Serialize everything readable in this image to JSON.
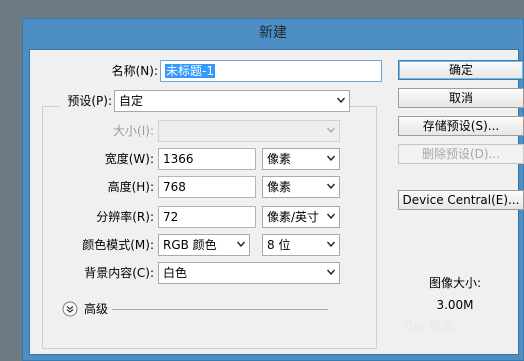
{
  "window": {
    "title": "新建"
  },
  "name_field": {
    "label": "名称(N):",
    "value": "未标题-1"
  },
  "preset": {
    "label": "预设(P):",
    "value": "自定"
  },
  "size": {
    "label": "大小(I):",
    "value": ""
  },
  "width": {
    "label": "宽度(W):",
    "value": "1366",
    "unit": "像素"
  },
  "height": {
    "label": "高度(H):",
    "value": "768",
    "unit": "像素"
  },
  "resolution": {
    "label": "分辨率(R):",
    "value": "72",
    "unit": "像素/英寸"
  },
  "color_mode": {
    "label": "颜色模式(M):",
    "mode": "RGB 颜色",
    "depth": "8 位"
  },
  "background": {
    "label": "背景内容(C):",
    "value": "白色"
  },
  "advanced": {
    "label": "高级"
  },
  "buttons": {
    "ok": "确定",
    "cancel": "取消",
    "save_preset": "存储预设(S)...",
    "delete_preset": "删除预设(D)...",
    "device_central": "Device Central(E)..."
  },
  "image_size": {
    "label": "图像大小:",
    "value": "3.00M"
  },
  "watermark": "Bai 经验"
}
